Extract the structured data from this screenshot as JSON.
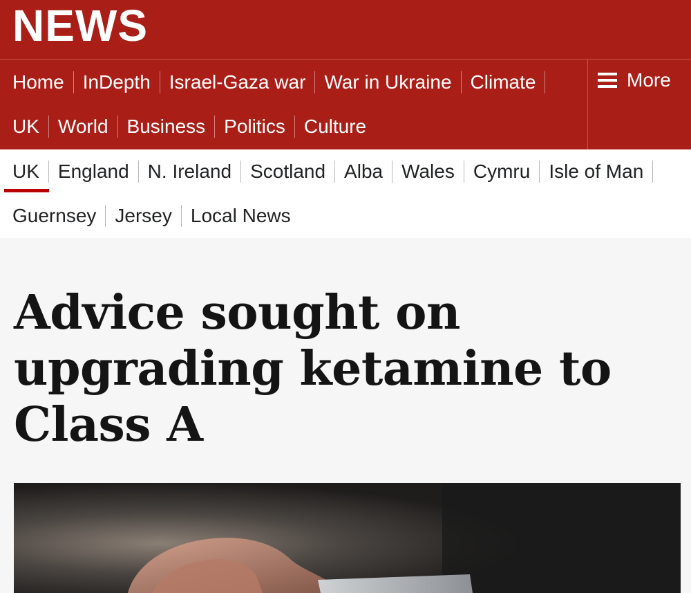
{
  "masthead": {
    "logo_text": "NEWS"
  },
  "primary_nav": {
    "row1": [
      "Home",
      "InDepth",
      "Israel-Gaza war",
      "War in Ukraine",
      "Climate"
    ],
    "row2": [
      "UK",
      "World",
      "Business",
      "Politics",
      "Culture"
    ],
    "more_label": "More"
  },
  "secondary_nav": {
    "row1": [
      "UK",
      "England",
      "N. Ireland",
      "Scotland",
      "Alba",
      "Wales",
      "Cymru",
      "Isle of Man"
    ],
    "row2": [
      "Guernsey",
      "Jersey",
      "Local News"
    ],
    "active": "UK"
  },
  "article": {
    "headline": "Advice sought on upgrading ketamine to Class A"
  },
  "colors": {
    "brand_red": "#a91f17",
    "active_underline": "#b80000",
    "page_bg": "#f6f6f6"
  },
  "icons": {
    "menu": "hamburger-icon"
  }
}
